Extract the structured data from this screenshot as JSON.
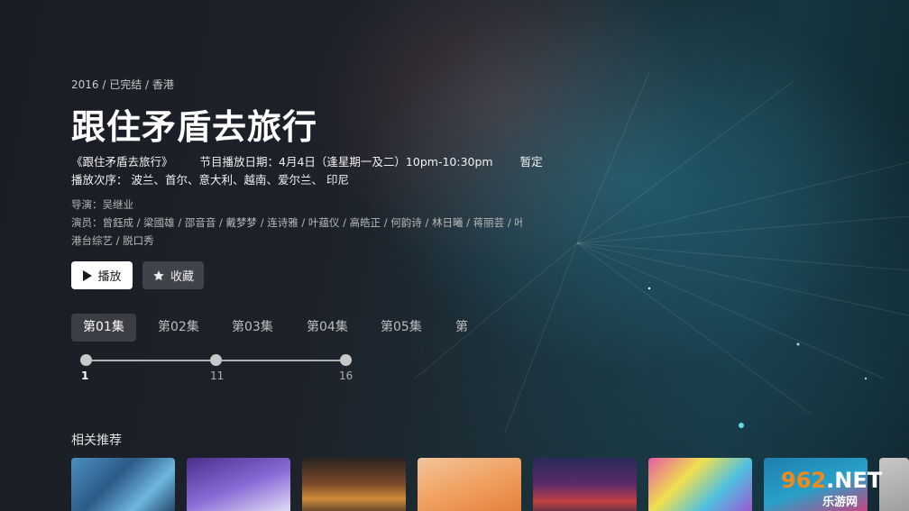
{
  "meta": {
    "year": "2016",
    "status": "已完结",
    "region": "香港"
  },
  "show": {
    "title": "跟住矛盾去旅行",
    "desc_name": "《跟住矛盾去旅行》",
    "desc_schedule": "节目播放日期：4月4日（逢星期一及二）10pm-10:30pm",
    "desc_tbd": "暂定",
    "desc_order": "播放次序： 波兰、首尔、意大利、越南、爱尔兰、 印尼"
  },
  "credits": {
    "director": "导演：吴继业",
    "cast": "演员：曾鈺成 / 梁國雄 / 邵音音 / 戴梦梦 / 连诗雅 / 叶蕴仪 / 高皓正 / 何韵诗 / 林日曦 / 蒋丽芸 / 叶姚…",
    "tags": "港台综艺 / 脱口秀"
  },
  "buttons": {
    "play_label": "播放",
    "favorite_label": "收藏",
    "play_icon": "play-icon",
    "favorite_icon": "star-icon"
  },
  "episodes": [
    "第01集",
    "第02集",
    "第03集",
    "第04集",
    "第05集",
    "第"
  ],
  "range_slider": {
    "labels": [
      "1",
      "11",
      "16"
    ],
    "selected_index": 0
  },
  "related": {
    "title": "相关推荐"
  },
  "watermark": {
    "brand_number": "962",
    "brand_suffix": ".NET",
    "brand_sub": "乐游网"
  },
  "colors": {
    "play_button_bg": "#ffffff",
    "watermark_orange": "#f08a1a"
  }
}
